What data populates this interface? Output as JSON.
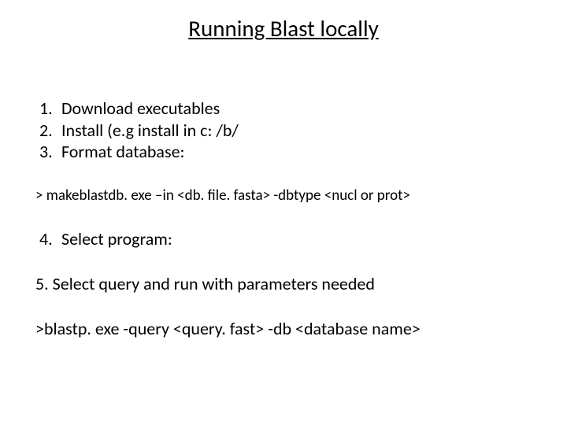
{
  "title": "Running Blast locally",
  "steps": {
    "n1": "1.",
    "t1": "Download executables",
    "n2": "2.",
    "t2": "Install (e.g install in c: /b/",
    "n3": "3.",
    "t3": "Format database:",
    "cmd1": "> makeblastdb. exe –in <db. file. fasta> -dbtype <nucl or prot>",
    "n4": "4.",
    "t4": "Select program:",
    "t5": "5. Select query and run with parameters needed",
    "cmd2": ">blastp. exe  -query <query. fast> -db <database name>"
  }
}
